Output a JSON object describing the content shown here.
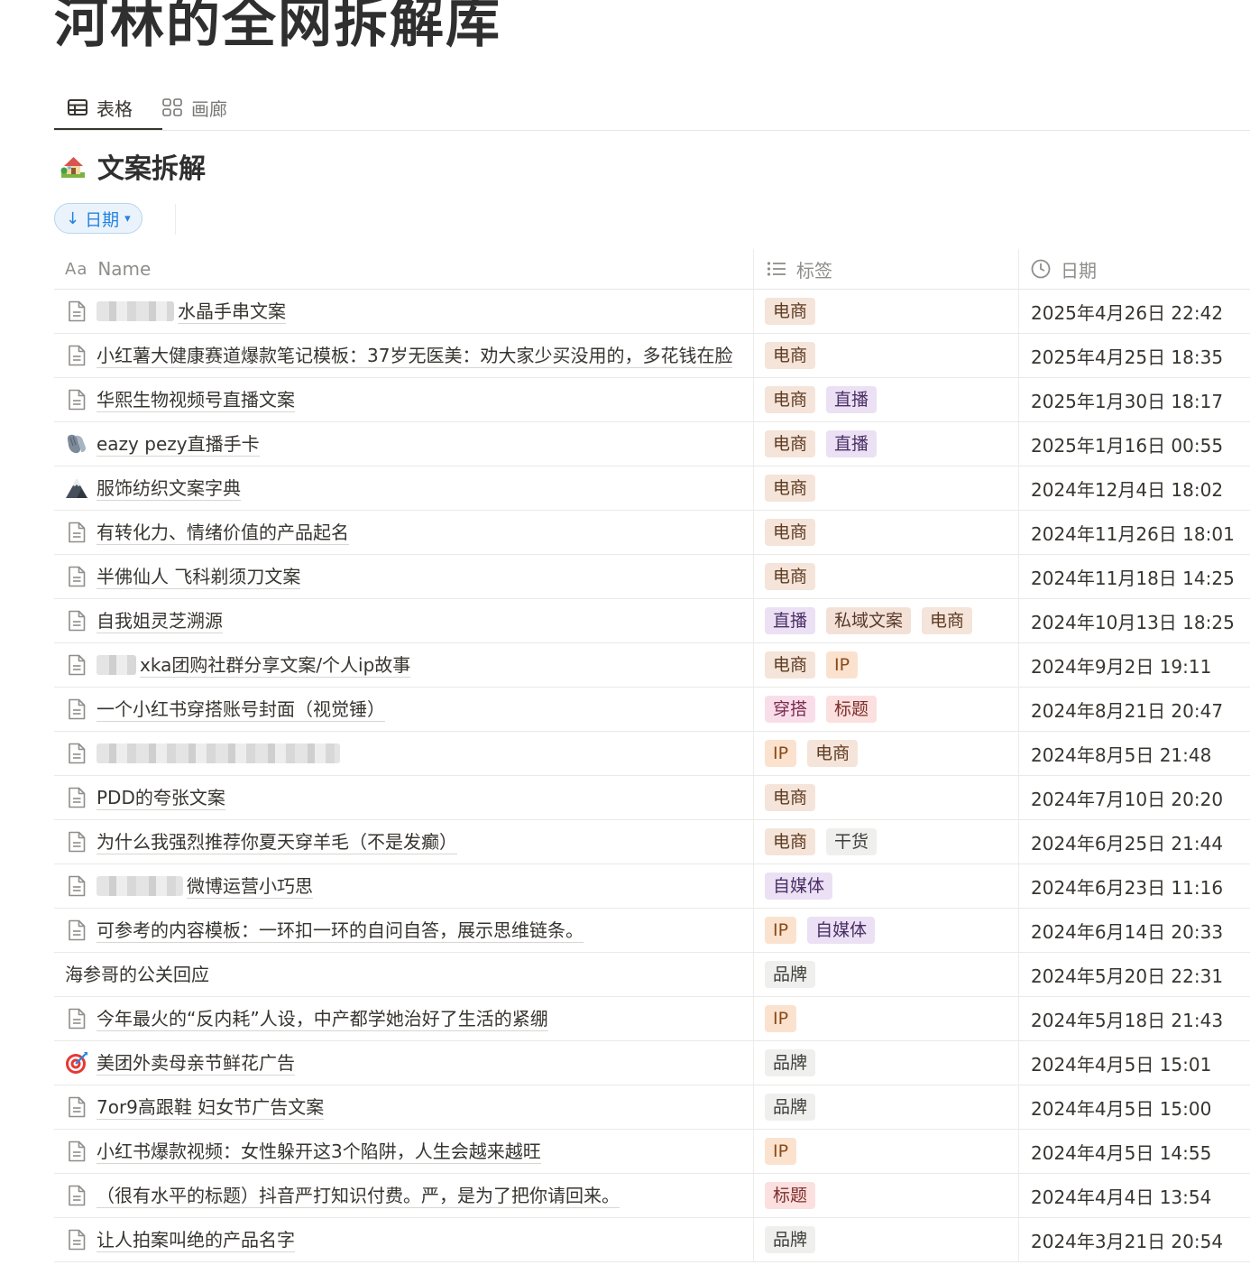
{
  "page": {
    "title": "河林的全网拆解库"
  },
  "view_tabs": [
    {
      "label": "表格",
      "icon": "table-icon",
      "active": true
    },
    {
      "label": "画廊",
      "icon": "gallery-grid-icon",
      "active": false
    }
  ],
  "database": {
    "icon": "house-emoji-icon",
    "title": "文案拆解"
  },
  "sort": {
    "label": "日期",
    "direction_icon": "arrow-down-icon",
    "dropdown_icon": "chevron-down-icon"
  },
  "columns": {
    "name": {
      "icon": "aa-text-icon",
      "icon_text": "Aa",
      "label": "Name"
    },
    "tags": {
      "icon": "multi-select-list-icon",
      "label": "标签"
    },
    "date": {
      "icon": "clock-icon",
      "label": "日期"
    }
  },
  "tag_colors": {
    "电商": "#f5e4d9",
    "直播": "#ebe0f4",
    "私域文案": "#f3e1d8",
    "IP": "#fbe2cf",
    "穿搭": "#f9deea",
    "标题": "#fbe0df",
    "干货": "#efefed",
    "自媒体": "#ebe0f4",
    "品牌": "#efefed"
  },
  "rows": [
    {
      "title": "水晶手串文案",
      "icon": "page-icon",
      "tags": [
        "电商"
      ],
      "date": "2025年4月26日 22:42"
    },
    {
      "title": "小红薯大健康赛道爆款笔记模板：37岁无医美：劝大家少买没用的，多花钱在脸",
      "icon": "page-icon",
      "tags": [
        "电商"
      ],
      "date": "2025年4月25日 18:35"
    },
    {
      "title": "华熙生物视频号直播文案",
      "icon": "page-icon",
      "tags": [
        "电商",
        "直播"
      ],
      "date": "2025年1月30日 18:17"
    },
    {
      "title": "eazy pezy直播手卡",
      "icon": "gloves-emoji-icon",
      "tags": [
        "电商",
        "直播"
      ],
      "date": "2025年1月16日 00:55"
    },
    {
      "title": "服饰纺织文案字典",
      "icon": "mountain-emoji-icon",
      "tags": [
        "电商"
      ],
      "date": "2024年12月4日 18:02"
    },
    {
      "title": "有转化力、情绪价值的产品起名",
      "icon": "page-icon",
      "tags": [
        "电商"
      ],
      "date": "2024年11月26日 18:01"
    },
    {
      "title": "半佛仙人 飞科剃须刀文案",
      "icon": "page-icon",
      "tags": [
        "电商"
      ],
      "date": "2024年11月18日 14:25"
    },
    {
      "title": "自我姐灵芝溯源",
      "icon": "page-icon",
      "tags": [
        "直播",
        "私域文案",
        "电商"
      ],
      "date": "2024年10月13日 18:25"
    },
    {
      "title": "xka团购社群分享文案/个人ip故事",
      "icon": "page-icon",
      "tags": [
        "电商",
        "IP"
      ],
      "date": "2024年9月2日 19:11"
    },
    {
      "title": "一个小红书穿搭账号封面（视觉锤）",
      "icon": "page-icon",
      "tags": [
        "穿搭",
        "标题"
      ],
      "date": "2024年8月21日 20:47"
    },
    {
      "title": "",
      "icon": "page-icon",
      "tags": [
        "IP",
        "电商"
      ],
      "date": "2024年8月5日 21:48"
    },
    {
      "title": "PDD的夸张文案",
      "icon": "page-icon",
      "tags": [
        "电商"
      ],
      "date": "2024年7月10日 20:20"
    },
    {
      "title": "为什么我强烈推荐你夏天穿羊毛（不是发癫）",
      "icon": "page-icon",
      "tags": [
        "电商",
        "干货"
      ],
      "date": "2024年6月25日 21:44"
    },
    {
      "title": "微博运营小巧思",
      "icon": "page-icon",
      "tags": [
        "自媒体"
      ],
      "date": "2024年6月23日 11:16"
    },
    {
      "title": "可参考的内容模板：一环扣一环的自问自答，展示思维链条。",
      "icon": "page-icon",
      "tags": [
        "IP",
        "自媒体"
      ],
      "date": "2024年6月14日 20:33"
    },
    {
      "title": "海参哥的公关回应",
      "icon": "",
      "tags": [
        "品牌"
      ],
      "date": "2024年5月20日 22:31"
    },
    {
      "title": "今年最火的“反内耗”人设，中产都学她治好了生活的紧绷",
      "icon": "page-icon",
      "tags": [
        "IP"
      ],
      "date": "2024年5月18日 21:43"
    },
    {
      "title": "美团外卖母亲节鲜花广告",
      "icon": "target-emoji-icon",
      "tags": [
        "品牌"
      ],
      "date": "2024年4月5日 15:01"
    },
    {
      "title": "7or9高跟鞋 妇女节广告文案",
      "icon": "page-icon",
      "tags": [
        "品牌"
      ],
      "date": "2024年4月5日 15:00"
    },
    {
      "title": "小红书爆款视频：女性躲开这3个陷阱，人生会越来越旺",
      "icon": "page-icon",
      "tags": [
        "IP"
      ],
      "date": "2024年4月5日 14:55"
    },
    {
      "title": "（很有水平的标题）抖音严打知识付费。严，是为了把你请回来。",
      "icon": "page-icon",
      "tags": [
        "标题"
      ],
      "date": "2024年4月4日 13:54"
    },
    {
      "title": "让人拍案叫绝的产品名字",
      "icon": "page-icon",
      "tags": [
        "品牌"
      ],
      "date": "2024年3月21日 20:54"
    }
  ]
}
